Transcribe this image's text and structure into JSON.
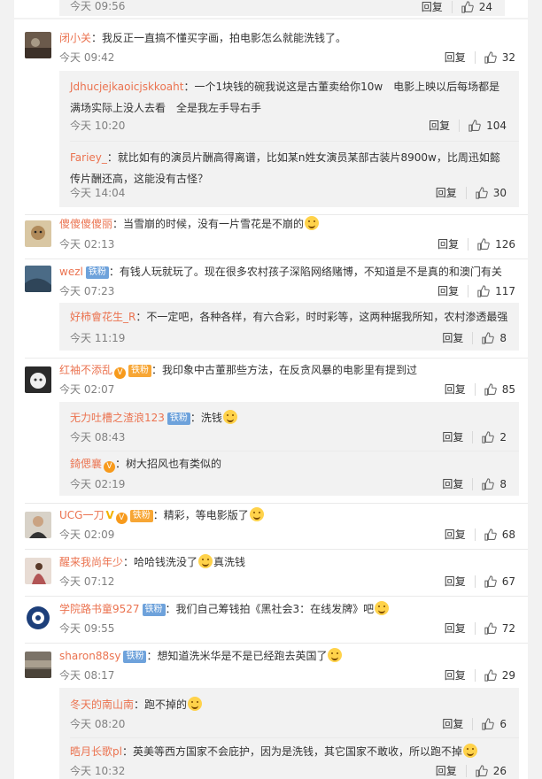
{
  "common": {
    "reply_label": "回复"
  },
  "top_remnant": {
    "time": "今天 09:56",
    "likes": "24"
  },
  "comments": [
    {
      "name": "闭小关",
      "text": "：我反正一直搞不懂买字画，拍电影怎么就能洗钱了。",
      "time": "今天 09:42",
      "likes": "32",
      "replies": [
        {
          "name": "Jdhucjejkaoicjskkoaht",
          "text": "：一个1块钱的碗我说这是古董卖给你10w　电影上映以后每场都是满场实际上没人去看　全是我左手导右手",
          "time": "今天 10:20",
          "likes": "104"
        },
        {
          "name": "Fariey_",
          "text": "：就比如有的演员片酬高得离谱，比如某n姓女演员某部古装片8900w，比周迅如懿传片酬还高，这能没有古怪？",
          "time": "今天 14:04",
          "likes": "30"
        }
      ]
    },
    {
      "name": "傻傻傻傻丽",
      "text": "：当雪崩的时候，没有一片雪花是不崩的",
      "time": "今天 02:13",
      "likes": "126",
      "replies": []
    },
    {
      "name": "wezl",
      "badge": "铁粉",
      "text": "：有钱人玩就玩了。现在很多农村孩子深陷网络赌博，不知道是不是真的和澳门有关",
      "time": "今天 07:23",
      "likes": "117",
      "replies": [
        {
          "name": "好柿會花生_R",
          "text": "：不一定吧，各种各样，有六合彩，时时彩等，这两种据我所知，农村渗透最强",
          "time": "今天 11:19",
          "likes": "8"
        }
      ]
    },
    {
      "name": "红袖不添乱",
      "badge": "铁粉",
      "text": "：我印象中古董那些方法，在反贪风暴的电影里有提到过",
      "time": "今天 02:07",
      "likes": "85",
      "replies": [
        {
          "name": "无力吐槽之渣浪123",
          "badge": "铁粉",
          "text": "：洗钱",
          "time": "今天 08:43",
          "likes": "2"
        },
        {
          "name": "錡偲襄",
          "text": "：树大招风也有类似的",
          "time": "今天 02:19",
          "likes": "8"
        }
      ]
    },
    {
      "name": "UCG一刀",
      "badge": "铁粉",
      "text": "：精彩，等电影版了",
      "time": "今天 02:09",
      "likes": "68",
      "replies": []
    },
    {
      "name": "醒来我尚年少",
      "text": "：哈哈钱洗没了",
      "text2": "真洗钱",
      "time": "今天 07:12",
      "likes": "67",
      "replies": []
    },
    {
      "name": "学院路书童9527",
      "badge": "铁粉",
      "text": "：我们自己筹钱拍《黑社会3：在线发牌》吧",
      "time": "今天 09:55",
      "likes": "72",
      "replies": []
    },
    {
      "name": "sharon88sy",
      "badge": "铁粉",
      "text": "：想知道洗米华是不是已经跑去英国了",
      "time": "今天 08:17",
      "likes": "29",
      "replies": [
        {
          "name": "冬天的南山南",
          "text": "：跑不掉的",
          "time": "今天 08:20",
          "likes": "6"
        },
        {
          "name": "晧月长歌pl",
          "text": "：英美等西方国家不会庇护，因为是洗钱，其它国家不敢收，所以跑不掉",
          "time": "今天 10:32",
          "likes": "26"
        }
      ]
    }
  ],
  "colors": {
    "username": "#eb7350",
    "background": "#f2f2f2",
    "reply_bg": "#f2f2f2",
    "badge": "#6ea2db"
  },
  "icons": {
    "like": "thumbs-up-icon",
    "emoji": "emoji-icon",
    "vip": "vip-badge-icon"
  }
}
